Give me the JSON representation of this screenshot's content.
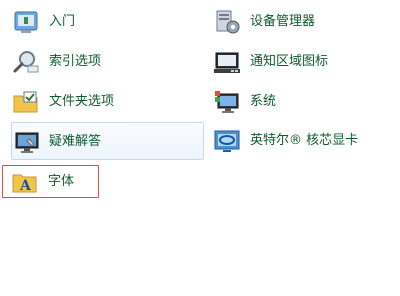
{
  "colors": {
    "link_text": "#0d5c2e",
    "hover_border": "#c6d8ee",
    "selection_border": "#e04a4a"
  },
  "items": [
    {
      "label": "入门",
      "icon": "getting-started-icon"
    },
    {
      "label": "设备管理器",
      "icon": "device-manager-icon"
    },
    {
      "label": "索引选项",
      "icon": "indexing-options-icon"
    },
    {
      "label": "通知区域图标",
      "icon": "notification-area-icons-icon"
    },
    {
      "label": "文件夹选项",
      "icon": "folder-options-icon"
    },
    {
      "label": "系统",
      "icon": "system-icon"
    },
    {
      "label": "疑难解答",
      "icon": "troubleshooting-icon"
    },
    {
      "label": "英特尔® 核芯显卡",
      "icon": "intel-graphics-icon"
    },
    {
      "label": "字体",
      "icon": "fonts-icon"
    }
  ]
}
